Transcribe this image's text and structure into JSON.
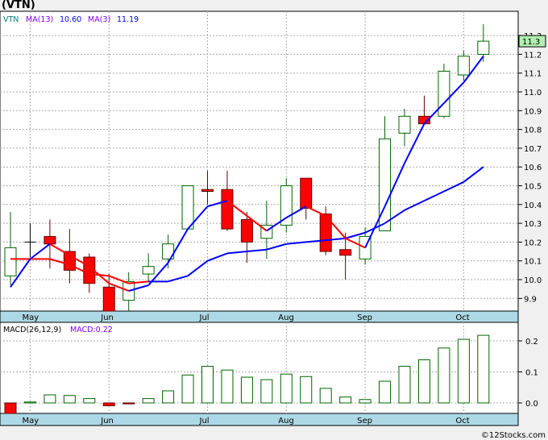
{
  "window": {
    "title": "(VTN)",
    "copyright": "©12Stocks.com"
  },
  "colors": {
    "up": "#006400",
    "down": "#ff0000",
    "ma_fast_up": "#0000ff",
    "ma_fast_down": "#ff0000",
    "ma_slow": "#0000ff",
    "axis_band": "#add8e6",
    "last_price_badge": "#b0f0b0"
  },
  "chart_data": [
    {
      "type": "candlestick",
      "title": "",
      "legend": {
        "symbol": "VTN",
        "ma13_label": "MA(13)",
        "ma13_value": "10.60",
        "ma3_label": "MA(3)",
        "ma3_value": "11.19"
      },
      "last_price_label": "11.3",
      "ylim": [
        9.82,
        11.4
      ],
      "yticks": [
        "9.9",
        "10.0",
        "10.1",
        "10.2",
        "10.3",
        "10.4",
        "10.5",
        "10.6",
        "10.7",
        "10.8",
        "10.9",
        "11.0",
        "11.1",
        "11.2",
        "11.3"
      ],
      "month_labels": [
        {
          "label": "May",
          "index": 1
        },
        {
          "label": "Jun",
          "index": 5
        },
        {
          "label": "Jul",
          "index": 10
        },
        {
          "label": "Aug",
          "index": 14
        },
        {
          "label": "Sep",
          "index": 18
        },
        {
          "label": "Oct",
          "index": 23
        }
      ],
      "grid": true,
      "candles": [
        {
          "o": 10.02,
          "h": 10.36,
          "l": 9.97,
          "c": 10.17
        },
        {
          "o": 10.2,
          "h": 10.3,
          "l": 10.12,
          "c": 10.2
        },
        {
          "o": 10.23,
          "h": 10.32,
          "l": 10.06,
          "c": 10.19
        },
        {
          "o": 10.15,
          "h": 10.27,
          "l": 9.98,
          "c": 10.05
        },
        {
          "o": 10.12,
          "h": 10.14,
          "l": 9.93,
          "c": 9.98
        },
        {
          "o": 9.96,
          "h": 10.03,
          "l": 9.82,
          "c": 9.83
        },
        {
          "o": 9.89,
          "h": 10.04,
          "l": 9.83,
          "c": 9.99
        },
        {
          "o": 10.03,
          "h": 10.14,
          "l": 9.99,
          "c": 10.07
        },
        {
          "o": 10.11,
          "h": 10.24,
          "l": 10.06,
          "c": 10.19
        },
        {
          "o": 10.27,
          "h": 10.5,
          "l": 10.27,
          "c": 10.5
        },
        {
          "o": 10.48,
          "h": 10.58,
          "l": 10.4,
          "c": 10.47
        },
        {
          "o": 10.48,
          "h": 10.58,
          "l": 10.26,
          "c": 10.27
        },
        {
          "o": 10.32,
          "h": 10.36,
          "l": 10.09,
          "c": 10.2
        },
        {
          "o": 10.22,
          "h": 10.42,
          "l": 10.11,
          "c": 10.29
        },
        {
          "o": 10.29,
          "h": 10.54,
          "l": 10.25,
          "c": 10.5
        },
        {
          "o": 10.54,
          "h": 10.54,
          "l": 10.32,
          "c": 10.38
        },
        {
          "o": 10.35,
          "h": 10.39,
          "l": 10.13,
          "c": 10.15
        },
        {
          "o": 10.16,
          "h": 10.25,
          "l": 10.0,
          "c": 10.13
        },
        {
          "o": 10.11,
          "h": 10.28,
          "l": 10.08,
          "c": 10.23
        },
        {
          "o": 10.26,
          "h": 10.87,
          "l": 10.26,
          "c": 10.75
        },
        {
          "o": 10.78,
          "h": 10.91,
          "l": 10.71,
          "c": 10.87
        },
        {
          "o": 10.87,
          "h": 10.98,
          "l": 10.83,
          "c": 10.83
        },
        {
          "o": 10.87,
          "h": 11.15,
          "l": 10.86,
          "c": 11.11
        },
        {
          "o": 11.09,
          "h": 11.22,
          "l": 11.06,
          "c": 11.19
        },
        {
          "o": 11.2,
          "h": 11.36,
          "l": 11.16,
          "c": 11.27
        }
      ],
      "ma3": [
        9.96,
        10.11,
        10.19,
        10.13,
        10.07,
        9.98,
        9.94,
        9.97,
        10.09,
        10.27,
        10.39,
        10.42,
        10.34,
        10.26,
        10.33,
        10.39,
        10.34,
        10.22,
        10.17,
        10.39,
        10.62,
        10.83,
        10.94,
        11.05,
        11.19
      ],
      "ma13": [
        10.11,
        10.11,
        10.11,
        10.08,
        10.03,
        10.02,
        9.98,
        9.99,
        9.99,
        10.02,
        10.1,
        10.14,
        10.15,
        10.16,
        10.19,
        10.2,
        10.21,
        10.22,
        10.25,
        10.3,
        10.37,
        10.42,
        10.47,
        10.52,
        10.6
      ]
    },
    {
      "type": "bar",
      "legend": {
        "label": "MACD(26,12,9)",
        "value_label": "MACD:0.22"
      },
      "ylim": [
        -0.04,
        0.25
      ],
      "yticks": [
        "0.0",
        "0.1",
        "0.2"
      ],
      "grid": true,
      "values": [
        -0.034,
        0.003,
        0.026,
        0.024,
        0.014,
        -0.009,
        -0.003,
        0.014,
        0.039,
        0.09,
        0.118,
        0.106,
        0.083,
        0.075,
        0.093,
        0.085,
        0.047,
        0.019,
        0.011,
        0.07,
        0.118,
        0.139,
        0.177,
        0.205,
        0.218
      ]
    }
  ]
}
